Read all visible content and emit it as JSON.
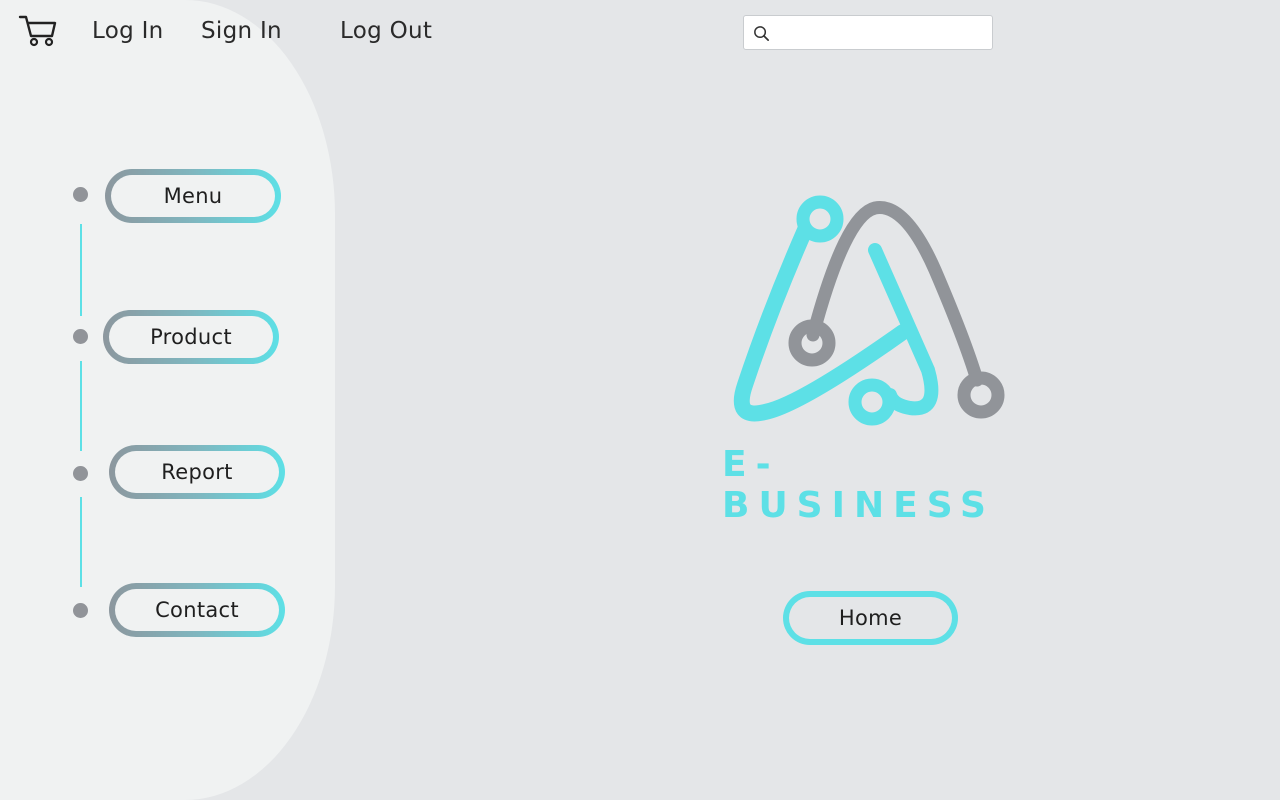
{
  "nav": {
    "cart_icon": "shopping-cart-icon",
    "log_in": "Log In",
    "sign_in": "Sign In",
    "log_out": "Log Out"
  },
  "search": {
    "icon": "search-icon",
    "value": "",
    "placeholder": ""
  },
  "sidebar": {
    "items": [
      {
        "label": "Menu"
      },
      {
        "label": "Product"
      },
      {
        "label": "Report"
      },
      {
        "label": "Contact"
      }
    ]
  },
  "main": {
    "brand_name": "E-BUSINESS",
    "home_label": "Home"
  },
  "colors": {
    "accent": "#5de0e6",
    "grey": "#919499",
    "background": "#e4e6e8",
    "panel": "#f0f2f2"
  }
}
